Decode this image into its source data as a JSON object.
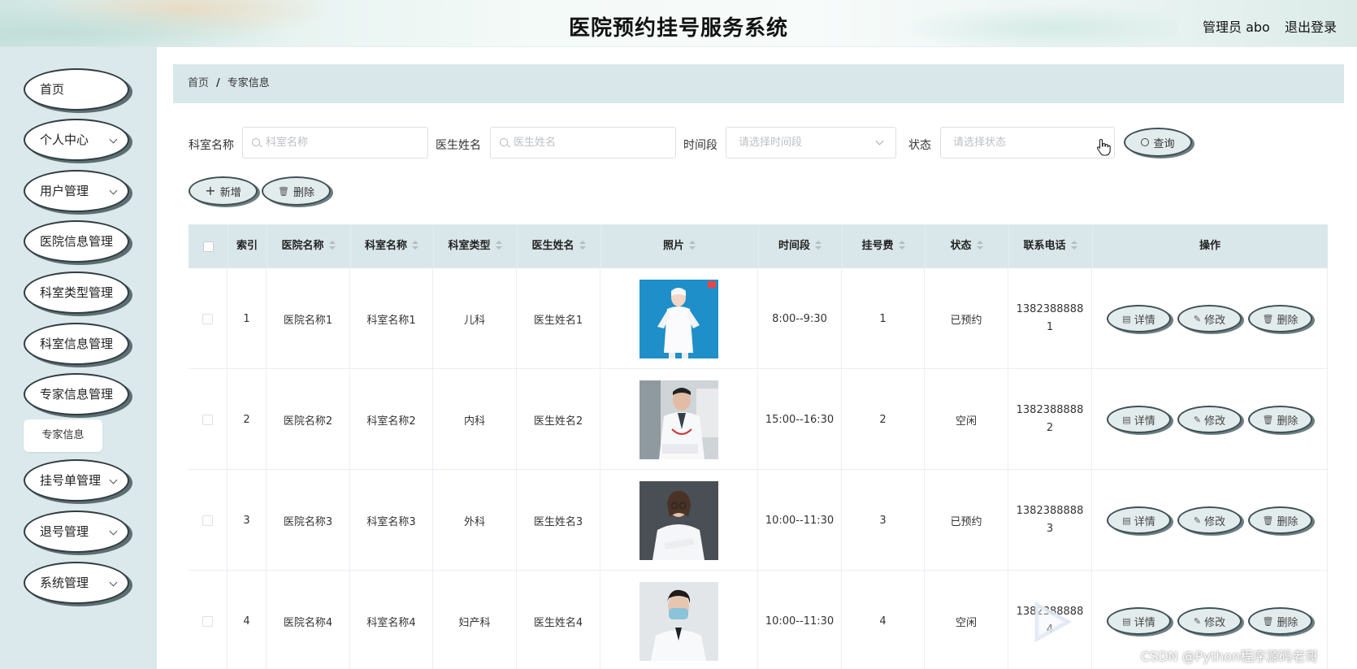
{
  "header": {
    "title": "医院预约挂号服务系统",
    "user": "管理员 abo",
    "logout": "退出登录"
  },
  "sidebar": {
    "items": [
      {
        "label": "首页",
        "has_sub": false
      },
      {
        "label": "个人中心",
        "has_sub": true
      },
      {
        "label": "用户管理",
        "has_sub": true
      },
      {
        "label": "医院信息管理",
        "has_sub": false
      },
      {
        "label": "科室类型管理",
        "has_sub": false
      },
      {
        "label": "科室信息管理",
        "has_sub": false
      },
      {
        "label": "专家信息管理",
        "has_sub": false
      },
      {
        "label": "挂号单管理",
        "has_sub": true
      },
      {
        "label": "退号管理",
        "has_sub": true
      },
      {
        "label": "系统管理",
        "has_sub": true
      }
    ],
    "active_sub": "专家信息"
  },
  "breadcrumb": {
    "home": "首页",
    "separator": "/",
    "current": "专家信息"
  },
  "filters": {
    "dept_label": "科室名称",
    "dept_placeholder": "科室名称",
    "doctor_label": "医生姓名",
    "doctor_placeholder": "医生姓名",
    "time_label": "时间段",
    "time_placeholder": "请选择时间段",
    "status_label": "状态",
    "status_placeholder": "请选择状态",
    "query_button": "查询"
  },
  "actions": {
    "add": "新增",
    "delete": "删除"
  },
  "table": {
    "columns": [
      "索引",
      "医院名称",
      "科室名称",
      "科室类型",
      "医生姓名",
      "照片",
      "时间段",
      "挂号费",
      "状态",
      "联系电话",
      "操作"
    ],
    "rows": [
      {
        "index": "1",
        "hospital": "医院名称1",
        "dept": "科室名称1",
        "dept_type": "儿科",
        "doctor": "医生姓名1",
        "time": "8:00--9:30",
        "fee": "1",
        "status": "已预约",
        "phone": "13823888881"
      },
      {
        "index": "2",
        "hospital": "医院名称2",
        "dept": "科室名称2",
        "dept_type": "内科",
        "doctor": "医生姓名2",
        "time": "15:00--16:30",
        "fee": "2",
        "status": "空闲",
        "phone": "13823888882"
      },
      {
        "index": "3",
        "hospital": "医院名称3",
        "dept": "科室名称3",
        "dept_type": "外科",
        "doctor": "医生姓名3",
        "time": "10:00--11:30",
        "fee": "3",
        "status": "已预约",
        "phone": "13823888883"
      },
      {
        "index": "4",
        "hospital": "医院名称4",
        "dept": "科室名称4",
        "dept_type": "妇产科",
        "doctor": "医生姓名4",
        "time": "10:00--11:30",
        "fee": "4",
        "status": "空闲",
        "phone": "13823888884"
      }
    ],
    "row_actions": {
      "detail": "详情",
      "edit": "修改",
      "delete": "删除"
    }
  },
  "watermark": "CSDN @Python程序源码老哥",
  "colors": {
    "sidebar_bg": "#dbe9ec",
    "header_row_bg": "#dae7ea",
    "pill_border": "#3f5055"
  }
}
